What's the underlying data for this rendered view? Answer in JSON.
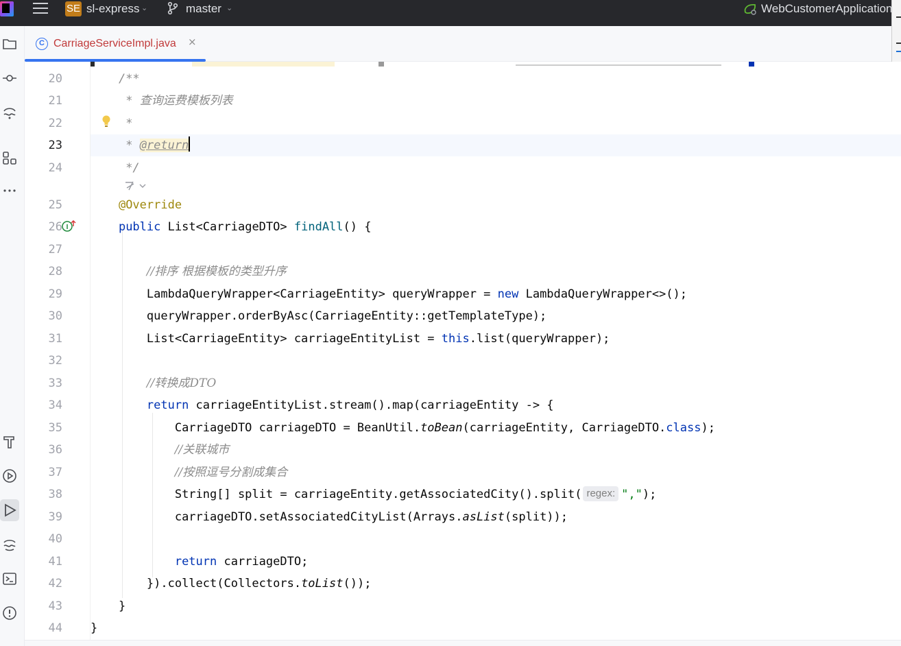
{
  "titlebar": {
    "project_badge": "SE",
    "project_name": "sl-express",
    "branch": "master",
    "run_config": "WebCustomerApplication"
  },
  "tabs": [
    {
      "label": "CarriageServiceImpl.java",
      "icon": "class-icon",
      "active": true
    }
  ],
  "toolstrip_icons": [
    "project-icon",
    "commit-icon",
    "pull-requests-icon",
    "structure-icon",
    "more-icon",
    "build-icon",
    "services-icon",
    "run-icon",
    "problems-wave-icon",
    "terminal-icon",
    "problems-icon"
  ],
  "colors": {
    "accent": "#3574f0",
    "keyword": "#0033b3",
    "method": "#00627a",
    "string": "#067d17",
    "annotation": "#9e880d",
    "comment": "#8c8c8c",
    "titlebar_bg": "#27282c"
  },
  "editor": {
    "current_line": 23,
    "lines": [
      {
        "n": "20",
        "text": "    /**"
      },
      {
        "n": "21",
        "text": "     * 查询运费模板列表"
      },
      {
        "n": "22",
        "text": "     *"
      },
      {
        "n": "23",
        "text": "     * @return"
      },
      {
        "n": "24",
        "text": "     */"
      },
      {
        "n": "25",
        "text": "    @Override"
      },
      {
        "n": "26",
        "text": "    public List<CarriageDTO> findAll() {"
      },
      {
        "n": "27",
        "text": ""
      },
      {
        "n": "28",
        "text": "        //排序 根据模板的类型升序"
      },
      {
        "n": "29",
        "text": "        LambdaQueryWrapper<CarriageEntity> queryWrapper = new LambdaQueryWrapper<>();"
      },
      {
        "n": "30",
        "text": "        queryWrapper.orderByAsc(CarriageEntity::getTemplateType);"
      },
      {
        "n": "31",
        "text": "        List<CarriageEntity> carriageEntityList = this.list(queryWrapper);"
      },
      {
        "n": "32",
        "text": ""
      },
      {
        "n": "33",
        "text": "        //转换成DTO"
      },
      {
        "n": "34",
        "text": "        return carriageEntityList.stream().map(carriageEntity -> {"
      },
      {
        "n": "35",
        "text": "            CarriageDTO carriageDTO = BeanUtil.toBean(carriageEntity, CarriageDTO.class);"
      },
      {
        "n": "36",
        "text": "            //关联城市"
      },
      {
        "n": "37",
        "text": "            //按照逗号分割成集合"
      },
      {
        "n": "38",
        "text": "            String[] split = carriageEntity.getAssociatedCity().split( regex: \",\");"
      },
      {
        "n": "39",
        "text": "            carriageDTO.setAssociatedCityList(Arrays.asList(split));"
      },
      {
        "n": "40",
        "text": ""
      },
      {
        "n": "41",
        "text": "            return carriageDTO;"
      },
      {
        "n": "42",
        "text": "        }).collect(Collectors.toList());"
      },
      {
        "n": "43",
        "text": "    }"
      },
      {
        "n": "44",
        "text": "}"
      }
    ],
    "tokens": {
      "doc_open": "/**",
      "doc_star": "*",
      "doc_title": "查询运费模板列表",
      "doc_return": "@return",
      "doc_close": "*/",
      "override": "@Override",
      "public": "public",
      "list_type": "List<CarriageDTO>",
      "find_all": "findAll",
      "find_all_tail": "() {",
      "cm_sort": "//排序 根据模板的类型升序",
      "l29_a": "LambdaQueryWrapper<CarriageEntity> queryWrapper = ",
      "new": "new",
      "l29_b": " LambdaQueryWrapper<>();",
      "l30": "queryWrapper.orderByAsc(CarriageEntity::getTemplateType);",
      "l31_a": "List<CarriageEntity> carriageEntityList = ",
      "this": "this",
      "l31_b": ".list(queryWrapper);",
      "cm_dto": "//转换成DTO",
      "return": "return",
      "l34_b": " carriageEntityList.stream().map(carriageEntity -> {",
      "l35_a": "CarriageDTO carriageDTO = BeanUtil.",
      "to_bean": "toBean",
      "l35_b": "(carriageEntity, CarriageDTO.",
      "class": "class",
      "l35_c": ");",
      "cm_city": "//关联城市",
      "cm_split": "//按照逗号分割成集合",
      "l38_a": "String[] split = carriageEntity.getAssociatedCity().split(",
      "regex_hint": "regex:",
      "comma_str": "\",\"",
      "l38_b": ");",
      "l39_a": "carriageDTO.setAssociatedCityList(Arrays.",
      "as_list": "asList",
      "l39_b": "(split));",
      "l41_b": " carriageDTO;",
      "l42_a": "}).collect(Collectors.",
      "to_list": "toList",
      "l42_b": "());",
      "close_brace": "}"
    }
  }
}
